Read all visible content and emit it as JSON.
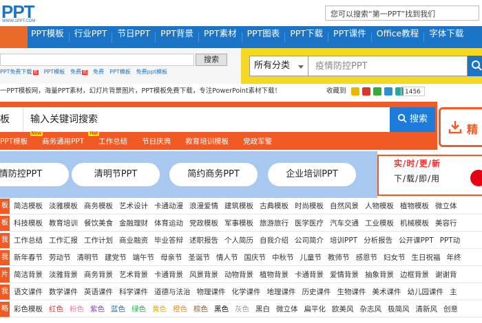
{
  "logo": {
    "text": "PPT",
    "sub": "WWW.1PPT.COM"
  },
  "top_search": {
    "placeholder": "您可以搜索“第一PPT”找到我们"
  },
  "nav": [
    "PPT模板",
    "行业PPT",
    "节日PPT",
    "PPT背景",
    "PPT素材",
    "PPT图表",
    "PPT下载",
    "PPT课件",
    "Office教程",
    "字体下载"
  ],
  "mini_search": {
    "button": "搜索"
  },
  "mini_tags": [
    {
      "label": "PPT免费下载",
      "hot": true
    },
    {
      "label": "PPT模板",
      "hot": false
    },
    {
      "label": "免费",
      "hot": true
    },
    {
      "label": "免费",
      "hot": false
    },
    {
      "label": "PPT模板",
      "hot": false
    },
    {
      "label": "免费ppt模板",
      "hot": false
    }
  ],
  "category_search": {
    "select": "所有分类",
    "placeholder": "疫情防控PPT"
  },
  "info": {
    "text": "一PPT模板网，海量PPT素材，幻灯片背景图片，PPT模板免费下载，专注PowerPoint素材下载！",
    "fav_label": "收藏到",
    "count": "1456",
    "fav_colors": [
      "#f0b400",
      "#d9362b",
      "#3aa83a",
      "#2d8fd6",
      "#2aa7a0"
    ]
  },
  "main_search": {
    "type_label": "板",
    "placeholder": "输入关键词搜索",
    "button": "搜索"
  },
  "subnav": [
    {
      "label": "PPT模板",
      "badge": "New"
    },
    {
      "label": "商务通用PPT",
      "badge": "Hot"
    },
    {
      "label": "工作总结",
      "badge": ""
    },
    {
      "label": "节日庆典",
      "badge": ""
    },
    {
      "label": "教育培训模板",
      "badge": ""
    },
    {
      "label": "党政军警",
      "badge": ""
    }
  ],
  "jingpin": "精",
  "pills": [
    "情防控PPT",
    "清明节PPT",
    "简约商务PPT",
    "企业培训PPT"
  ],
  "promo": {
    "line1": "实/时/更/新",
    "line2": "下/载/即/用"
  },
  "grid": [
    {
      "tag": "板",
      "items": [
        "简洁模板",
        "淡雅模板",
        "商务模板",
        "艺术设计",
        "卡通动漫",
        "浪漫爱情",
        "建筑模板",
        "古典模板",
        "时尚模板",
        "自然风景",
        "人物模板",
        "植物模板",
        "微立体"
      ]
    },
    {
      "tag": "板",
      "items": [
        "科技模板",
        "教育培训",
        "餐饮美食",
        "金融理财",
        "体育运动",
        "党政模板",
        "军事模板",
        "旅游旅行",
        "医学医疗",
        "汽车交通",
        "工业模板",
        "机械模板",
        "美容行"
      ]
    },
    {
      "tag": "我",
      "items": [
        "工作总结",
        "工作汇报",
        "工作计划",
        "商业融资",
        "毕业答辩",
        "述职报告",
        "个人简历",
        "自我介绍",
        "公司简介",
        "培训PPT",
        "分析报告",
        "公开课PPT",
        "PPT动"
      ]
    },
    {
      "tag": "我",
      "items": [
        "新年春节",
        "劳动节",
        "清明节",
        "建党节",
        "端午节",
        "母亲节",
        "圣诞节",
        "情人节",
        "国庆节",
        "中秋节",
        "儿童节",
        "教师节",
        "感恩节",
        "妇女节",
        "生日祝福",
        "年终"
      ]
    },
    {
      "tag": "片",
      "items": [
        "简洁背景",
        "淡雅背景",
        "商务背景",
        "艺术背景",
        "卡通背景",
        "风景背景",
        "动物背景",
        "植物背景",
        "卡通背景",
        "爱情背景",
        "抽象背景",
        "边框背景",
        "谢谢背"
      ]
    },
    {
      "tag": "我",
      "items": [
        "语文课件",
        "数学课件",
        "英语课件",
        "科学课件",
        "道德与法治",
        "物理课件",
        "化学课件",
        "地理课件",
        "历史课件",
        "生物课件",
        "美术课件",
        "幼儿园课件",
        "主"
      ]
    },
    {
      "tag": "略",
      "items": [
        "彩色模板",
        "红色",
        "粉色",
        "紫色",
        "蓝色",
        "绿色",
        "黄色",
        "橙色",
        "棕色",
        "黑色",
        "灰色",
        "黑白",
        "微立体",
        "扁平化",
        "欧美风",
        "杂志风",
        "极简风",
        "清新风",
        "创意"
      ]
    }
  ],
  "colors": {
    "brand_blue": "#1b74c5",
    "orange": "#f15a24",
    "yellow": "#f5d824",
    "pill_bg": "#a9c8f0",
    "color_row": [
      "#333333",
      "#e33030",
      "#f07aa0",
      "#8a3fc7",
      "#1b74c5",
      "#2fa84f",
      "#e0b400",
      "#f08c1e",
      "#8b5a2b",
      "#111111",
      "#999999",
      "#333333",
      "#333333",
      "#333333",
      "#333333",
      "#333333",
      "#333333",
      "#333333",
      "#333333"
    ]
  }
}
